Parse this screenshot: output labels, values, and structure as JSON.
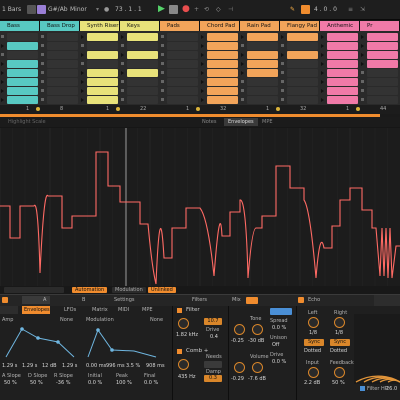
{
  "transport": {
    "bars_label": "1 Bars",
    "key_label": "G#/Ab",
    "scale_label": "Minor",
    "position": "73 . 1 . 1",
    "right_position": "4 . 0 . 0"
  },
  "tracks": [
    {
      "name": "Bass",
      "color": "#58c9c2"
    },
    {
      "name": "Bass Drop",
      "color": "#58c9c2"
    },
    {
      "name": "Synth Riser",
      "color": "#e8e27a"
    },
    {
      "name": "Keys",
      "color": "#e8e27a"
    },
    {
      "name": "Pads",
      "color": "#f2a45a"
    },
    {
      "name": "Chord Pad",
      "color": "#f2a45a"
    },
    {
      "name": "Rain Pad",
      "color": "#f2a45a"
    },
    {
      "name": "Flangy Pad",
      "color": "#f2a45a"
    },
    {
      "name": "Anthemic",
      "color": "#f07aa8"
    },
    {
      "name": "Pr",
      "color": "#f07aa8"
    }
  ],
  "mixer_numbers": [
    "1",
    "8",
    "1",
    "22",
    "1",
    "32",
    "1",
    "32",
    "1",
    "44"
  ],
  "clip_tabs": {
    "highlight": "Highlight Scale",
    "notes": "Notes",
    "envelopes": "Envelopes",
    "mpe": "MPE"
  },
  "env_strip": {
    "automation": "Automation",
    "modulation": "Modulation",
    "linked": "Unlinked"
  },
  "device_tabs": {
    "tab1": "A",
    "tab2": "B",
    "settings": "Settings",
    "filters": "Filters",
    "mix": "Mix",
    "fx": "Echo",
    "env_label": "Envelopes",
    "lfos": "LFOs",
    "matrix": "Matrix",
    "midi": "MIDI",
    "mpe": "MPE",
    "none1": "None",
    "modulation": "Modulation",
    "none2": "None"
  },
  "env1": {
    "values": [
      "1.29 s",
      "1.29 s",
      "12 dB",
      "1.29 s"
    ],
    "slopes": [
      "A Slope",
      "D Slope",
      "R Slope"
    ],
    "slope_vals": [
      "50 %",
      "50 %",
      "-36 %"
    ],
    "label": "Amp"
  },
  "env2": {
    "values": [
      "0.00 ms",
      "996 ms",
      "3.5 %",
      "908 ms"
    ],
    "row2": [
      "Initial",
      "Peak",
      "Final"
    ],
    "row2_vals": [
      "0.0 %",
      "100 %",
      "0.0 %"
    ]
  },
  "filter": {
    "title": "Filter",
    "freq": "1.82 kHz",
    "drive_label": "Drive",
    "drive": "0.4",
    "res": "10.7",
    "comb_title": "Comb +",
    "comb_freq": "435 Hz",
    "needs_label": "Needs",
    "damp_label": "Damp",
    "damp": "0.3"
  },
  "mixer_dev": {
    "tone": "Tone",
    "tone_val": "-30 dB",
    "vol_label": "Volume",
    "vol_val": "-7.6 dB",
    "spread": "Spread",
    "spread_val": "0.0 %",
    "unison": "Unison",
    "unison_val": "Off",
    "drive": "Drive",
    "drive_val": "0.0 %",
    "val1": "-0.25",
    "val2": "-0.29"
  },
  "echo": {
    "title": "Echo",
    "left": "Left",
    "right": "Right",
    "left_val": "1/8",
    "right_val": "1/8",
    "dotted_l": "Dotted",
    "dotted_r": "Dotted",
    "sync": "Sync",
    "input": "Input",
    "input_val": "2.2 dB",
    "feedback": "Feedback",
    "feedback_val": "50 %",
    "filter_hp": "Filter HP",
    "hp_val": "26.0"
  },
  "colors": {
    "accent": "#f08c2e",
    "env_line": "#ff6a64",
    "teal": "#58c9c2",
    "yellow": "#e8e27a",
    "orange": "#f2a45a",
    "pink": "#f07aa8"
  }
}
